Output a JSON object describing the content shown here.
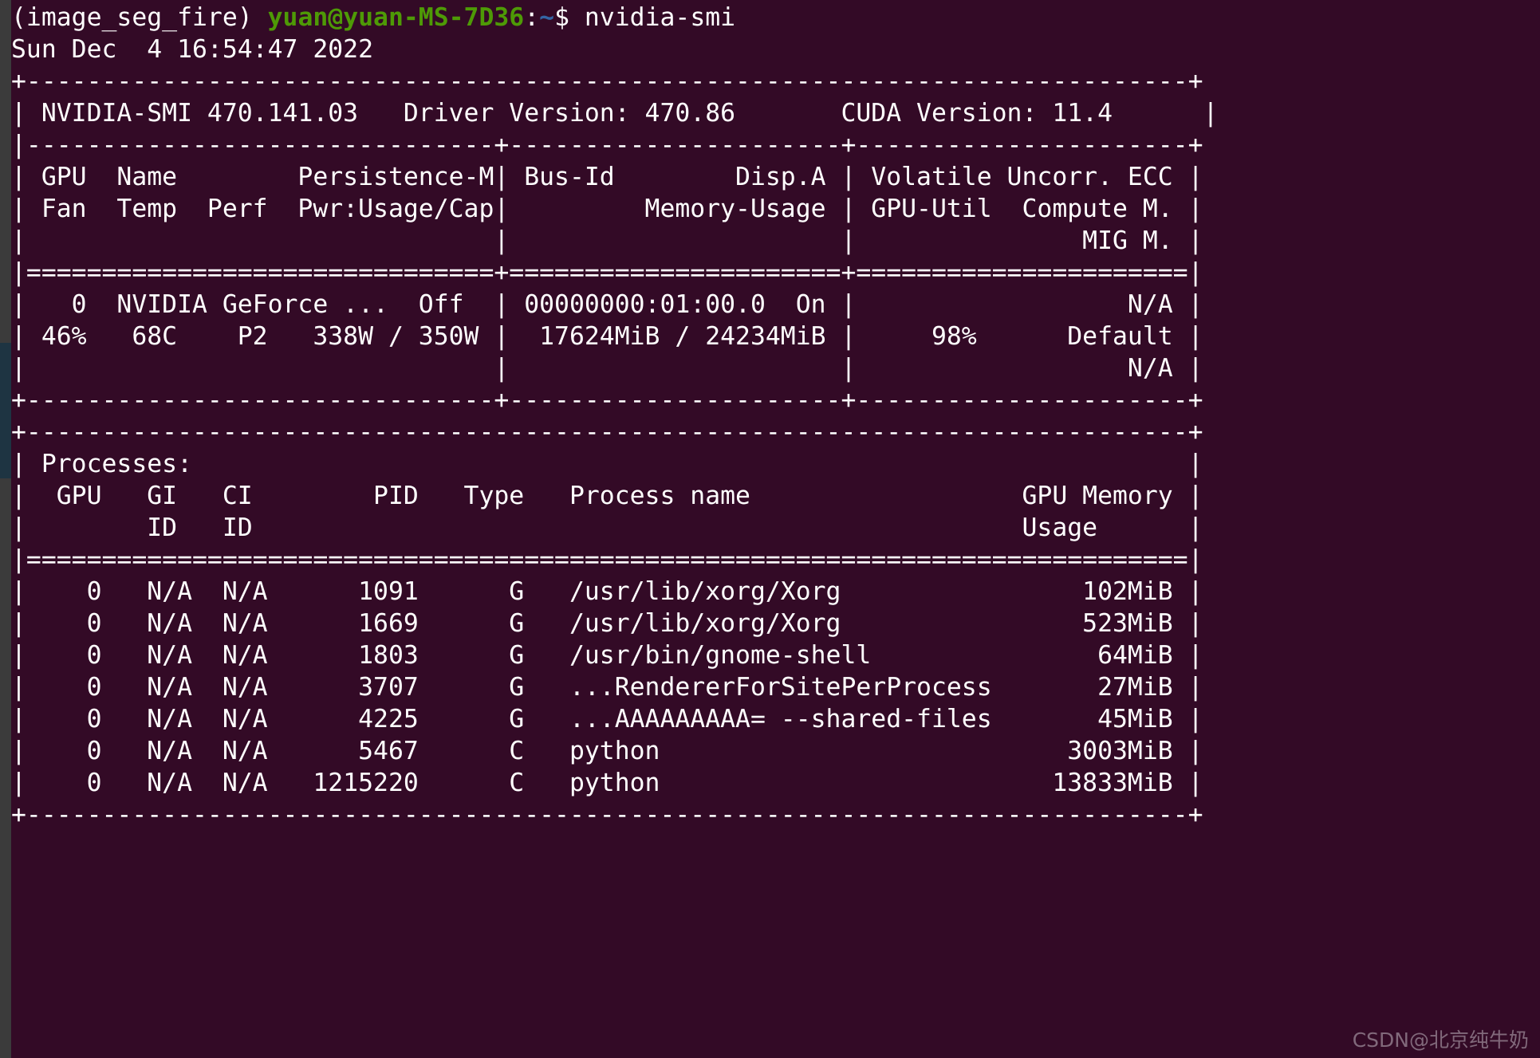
{
  "terminal": {
    "background_color": "#330a26",
    "foreground_color": "#ffffff",
    "accent_green": "#4e9a06",
    "accent_blue": "#3465a4",
    "scrollbar_color": "#3b3b3b",
    "scrollbar_thumb_color": "#1e3442"
  },
  "prompt": {
    "venv": "(image_seg_fire) ",
    "user_host": "yuan@yuan-MS-7D36",
    "colon": ":",
    "path": "~",
    "dollar": "$ ",
    "command": "nvidia-smi"
  },
  "timestamp": "Sun Dec  4 16:54:47 2022",
  "smi_header": {
    "tool": "NVIDIA-SMI 470.141.03",
    "driver": "Driver Version: 470.86",
    "cuda": "CUDA Version: 11.4"
  },
  "gpu_table": {
    "header_row_1": [
      "GPU",
      "Name",
      "Persistence-M",
      "Bus-Id",
      "Disp.A",
      "Volatile Uncorr. ECC"
    ],
    "header_row_2": [
      "Fan",
      "Temp",
      "Perf",
      "Pwr:Usage/Cap",
      "Memory-Usage",
      "GPU-Util",
      "Compute M."
    ],
    "header_row_3": [
      "MIG M."
    ],
    "rows": [
      {
        "gpu": "0",
        "name": "NVIDIA GeForce ...",
        "persistence_m": "Off",
        "bus_id": "00000000:01:00.0",
        "disp_a": "On",
        "ecc": "N/A",
        "fan": "46%",
        "temp": "68C",
        "perf": "P2",
        "pwr": "338W / 350W",
        "memory_usage": "17624MiB / 24234MiB",
        "gpu_util": "98%",
        "compute_m": "Default",
        "mig_m": "N/A"
      }
    ]
  },
  "processes_table": {
    "title": "Processes:",
    "columns": [
      "GPU",
      "GI",
      "CI",
      "PID",
      "Type",
      "Process name",
      "GPU Memory"
    ],
    "columns_line2": [
      "ID",
      "ID",
      "Usage"
    ],
    "rows": [
      {
        "gpu": "0",
        "gi_id": "N/A",
        "ci_id": "N/A",
        "pid": "1091",
        "type": "G",
        "name": "/usr/lib/xorg/Xorg",
        "memory": "102MiB"
      },
      {
        "gpu": "0",
        "gi_id": "N/A",
        "ci_id": "N/A",
        "pid": "1669",
        "type": "G",
        "name": "/usr/lib/xorg/Xorg",
        "memory": "523MiB"
      },
      {
        "gpu": "0",
        "gi_id": "N/A",
        "ci_id": "N/A",
        "pid": "1803",
        "type": "G",
        "name": "/usr/bin/gnome-shell",
        "memory": "64MiB"
      },
      {
        "gpu": "0",
        "gi_id": "N/A",
        "ci_id": "N/A",
        "pid": "3707",
        "type": "G",
        "name": "...RendererForSitePerProcess",
        "memory": "27MiB"
      },
      {
        "gpu": "0",
        "gi_id": "N/A",
        "ci_id": "N/A",
        "pid": "4225",
        "type": "G",
        "name": "...AAAAAAAAA= --shared-files",
        "memory": "45MiB"
      },
      {
        "gpu": "0",
        "gi_id": "N/A",
        "ci_id": "N/A",
        "pid": "5467",
        "type": "C",
        "name": "python",
        "memory": "3003MiB"
      },
      {
        "gpu": "0",
        "gi_id": "N/A",
        "ci_id": "N/A",
        "pid": "1215220",
        "type": "C",
        "name": "python",
        "memory": "13833MiB"
      }
    ]
  },
  "watermark": "CSDN@北京纯牛奶",
  "raw_lines": {
    "l_top_border": "+-----------------------------------------------------------------------------+",
    "l_smi": "| NVIDIA-SMI 470.141.03   Driver Version: 470.86       CUDA Version: 11.4      |",
    "l_sep1": "|-------------------------------+----------------------+----------------------+",
    "l_hdr1": "| GPU  Name        Persistence-M| Bus-Id        Disp.A | Volatile Uncorr. ECC |",
    "l_hdr2": "| Fan  Temp  Perf  Pwr:Usage/Cap|         Memory-Usage | GPU-Util  Compute M. |",
    "l_hdr3": "|                               |                      |               MIG M. |",
    "l_eq1": "|===============================+======================+======================|",
    "l_gpu0a": "|   0  NVIDIA GeForce ...  Off  | 00000000:01:00.0  On |                  N/A |",
    "l_gpu0b": "| 46%   68C    P2   338W / 350W |  17624MiB / 24234MiB |     98%      Default |",
    "l_gpu0c": "|                               |                      |                  N/A |",
    "l_bot1": "+-------------------------------+----------------------+----------------------+",
    "l_blank": "",
    "l_ptop": "+-----------------------------------------------------------------------------+",
    "l_ptitle": "| Processes:                                                                  |",
    "l_phdr1": "|  GPU   GI   CI        PID   Type   Process name                  GPU Memory |",
    "l_phdr2": "|        ID   ID                                                   Usage      |",
    "l_peq": "|=============================================================================|",
    "l_p1": "|    0   N/A  N/A      1091      G   /usr/lib/xorg/Xorg                102MiB |",
    "l_p2": "|    0   N/A  N/A      1669      G   /usr/lib/xorg/Xorg                523MiB |",
    "l_p3": "|    0   N/A  N/A      1803      G   /usr/bin/gnome-shell               64MiB |",
    "l_p4": "|    0   N/A  N/A      3707      G   ...RendererForSitePerProcess       27MiB |",
    "l_p5": "|    0   N/A  N/A      4225      G   ...AAAAAAAAA= --shared-files       45MiB |",
    "l_p6": "|    0   N/A  N/A      5467      C   python                           3003MiB |",
    "l_p7": "|    0   N/A  N/A   1215220      C   python                          13833MiB |",
    "l_pbot": "+-----------------------------------------------------------------------------+"
  }
}
